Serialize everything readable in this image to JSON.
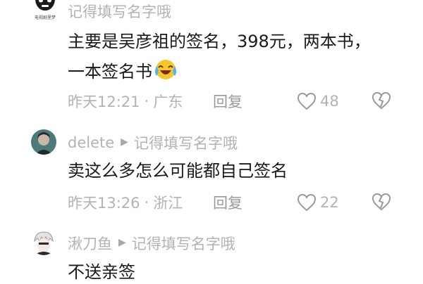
{
  "comments": [
    {
      "username": "记得填写名字哦",
      "avatar_caption": "电视剧里梦",
      "lines": [
        "主要是吴彦祖的签名，398元，两本书，",
        "一本签名书"
      ],
      "emoji": "laughing-crying-emoji",
      "time": "昨天12:21",
      "location": "广东",
      "reply_label": "回复",
      "likes": "48"
    },
    {
      "username": "delete",
      "reply_to": "记得填写名字哦",
      "lines": [
        "卖这么多怎么可能都自己签名"
      ],
      "time": "昨天13:26",
      "location": "浙江",
      "reply_label": "回复",
      "likes": "22"
    },
    {
      "username": "湫刀鱼",
      "reply_to": "记得填写名字哦",
      "lines": [
        "不送亲签"
      ]
    }
  ],
  "separator": "·",
  "reply_arrow": "▶",
  "icons": {
    "like": "heart-outline-icon",
    "dislike": "broken-heart-icon",
    "arrow": "reply-arrow-icon"
  },
  "colors": {
    "muted_text": "#b3b3b3",
    "body_text": "#1a1a1a"
  }
}
